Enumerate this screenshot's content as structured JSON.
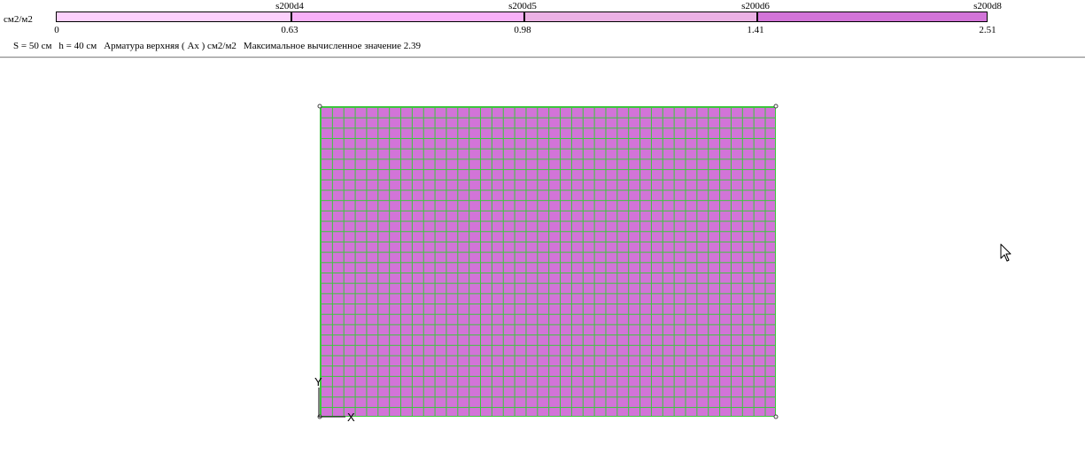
{
  "legend": {
    "units_label": "см2/м2",
    "segments": [
      {
        "name": "segment-1",
        "color": "#fcd0fc"
      },
      {
        "name": "segment-2",
        "color": "#f8b0f8"
      },
      {
        "name": "segment-3",
        "color": "#ebb1e4"
      },
      {
        "name": "segment-4",
        "color": "#d274d8"
      }
    ],
    "reinforcement_labels": [
      "s200d4",
      "s200d5",
      "s200d6",
      "s200d8"
    ],
    "value_labels": [
      "0",
      "0.63",
      "0.98",
      "1.41",
      "2.51"
    ]
  },
  "info": {
    "thickness_s": "S =  50 см",
    "height_h": "h =  40 см",
    "result_name": "Арматура верхняя ( Ax ) см2/м2",
    "max_value": "Максимальное вычисленное значение 2.39"
  },
  "plot": {
    "fill_color": "#d274d8",
    "grid_color": "#3bc63b",
    "axis_x_label": "X",
    "axis_y_label": "Y"
  }
}
